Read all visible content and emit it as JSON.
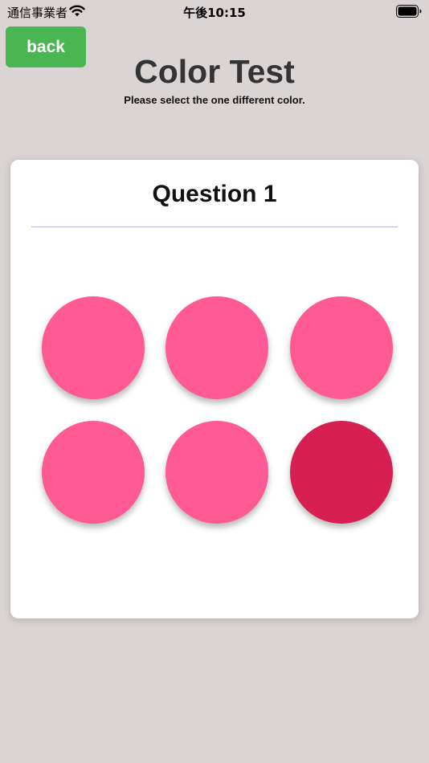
{
  "status_bar": {
    "carrier": "通信事業者",
    "time": "午後10:15"
  },
  "header": {
    "back_label": "back",
    "title": "Color Test",
    "subtitle": "Please select the one different color."
  },
  "quiz": {
    "question_label": "Question 1",
    "colors": {
      "base": "#ff5a93",
      "odd": "#d71f54",
      "back_button": "#4ab651"
    },
    "circles": [
      {
        "color": "#ff5a93"
      },
      {
        "color": "#ff5a93"
      },
      {
        "color": "#ff5a93"
      },
      {
        "color": "#ff5a93"
      },
      {
        "color": "#ff5a93"
      },
      {
        "color": "#d71f54"
      }
    ]
  }
}
